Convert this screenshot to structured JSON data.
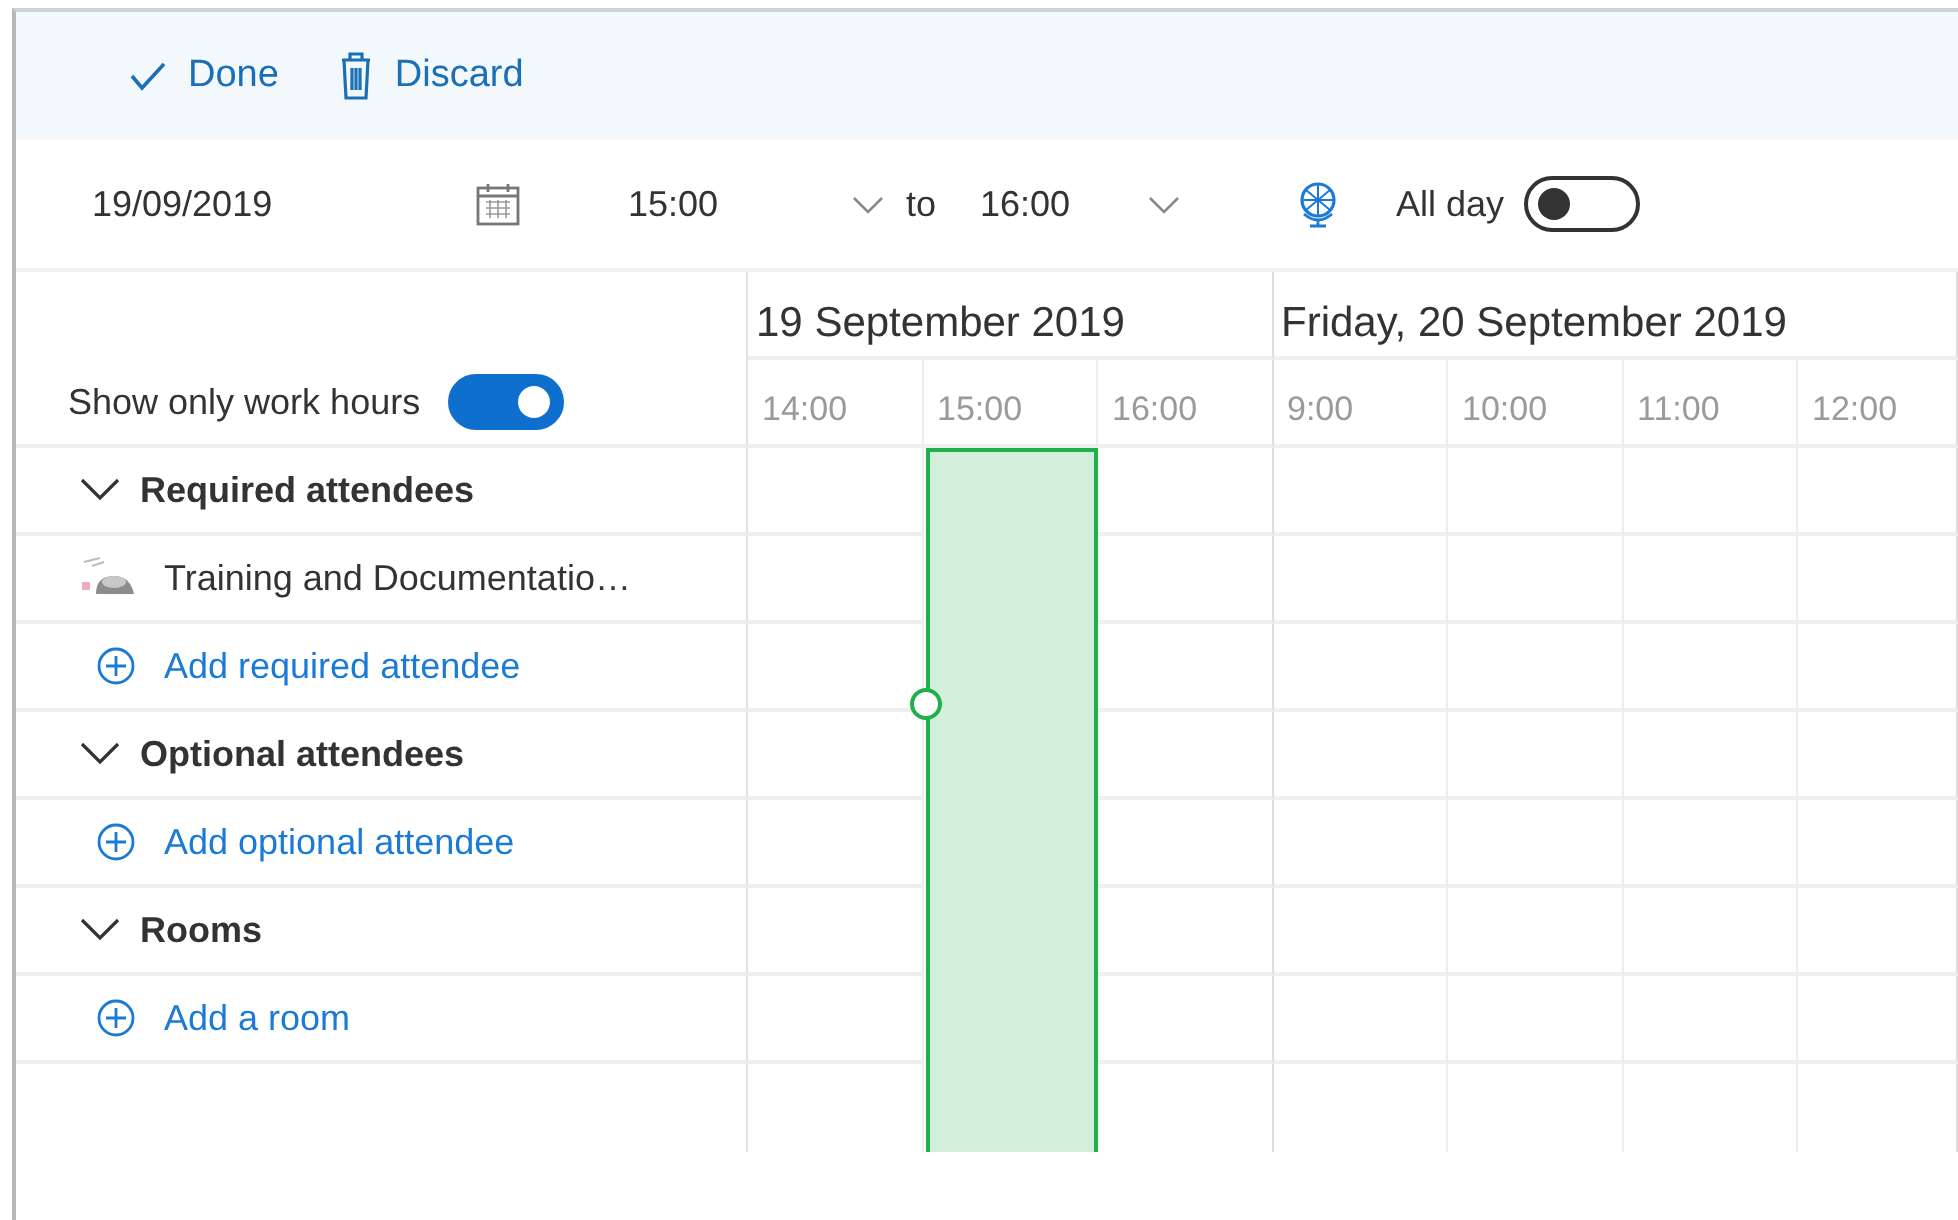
{
  "toolbar": [
    {
      "kind": "check",
      "label": "Done"
    },
    {
      "kind": "trash",
      "label": "Discard"
    }
  ],
  "time_row": {
    "date": "19/09/2019",
    "start": "15:00",
    "to": "to",
    "end": "16:00",
    "all_day": {
      "label": "All day",
      "on": false
    }
  },
  "work_hours": {
    "label": "Show only work hours",
    "on": true
  },
  "days": [
    {
      "label": "19 September 2019",
      "hours": [
        {
          "label": "14:00",
          "busy": false
        },
        {
          "label": "15:00",
          "busy": true
        },
        {
          "label": "16:00",
          "busy": false
        }
      ]
    },
    {
      "label": "Friday, 20 September 2019",
      "hours": [
        {
          "label": "9:00",
          "busy": false
        },
        {
          "label": "10:00",
          "busy": false
        },
        {
          "label": "11:00",
          "busy": false
        },
        {
          "label": "12:00",
          "busy": false
        }
      ]
    }
  ],
  "sections": [
    {
      "kind": "header",
      "label": "Required attendees",
      "expanded": true
    },
    {
      "kind": "attendee",
      "label": "Training and Documentatio…"
    },
    {
      "kind": "add",
      "label": "Add required attendee"
    },
    {
      "kind": "header",
      "label": "Optional attendees",
      "expanded": true
    },
    {
      "kind": "add",
      "label": "Add optional attendee"
    },
    {
      "kind": "header",
      "label": "Rooms",
      "expanded": true
    },
    {
      "kind": "add",
      "label": "Add a room"
    }
  ]
}
